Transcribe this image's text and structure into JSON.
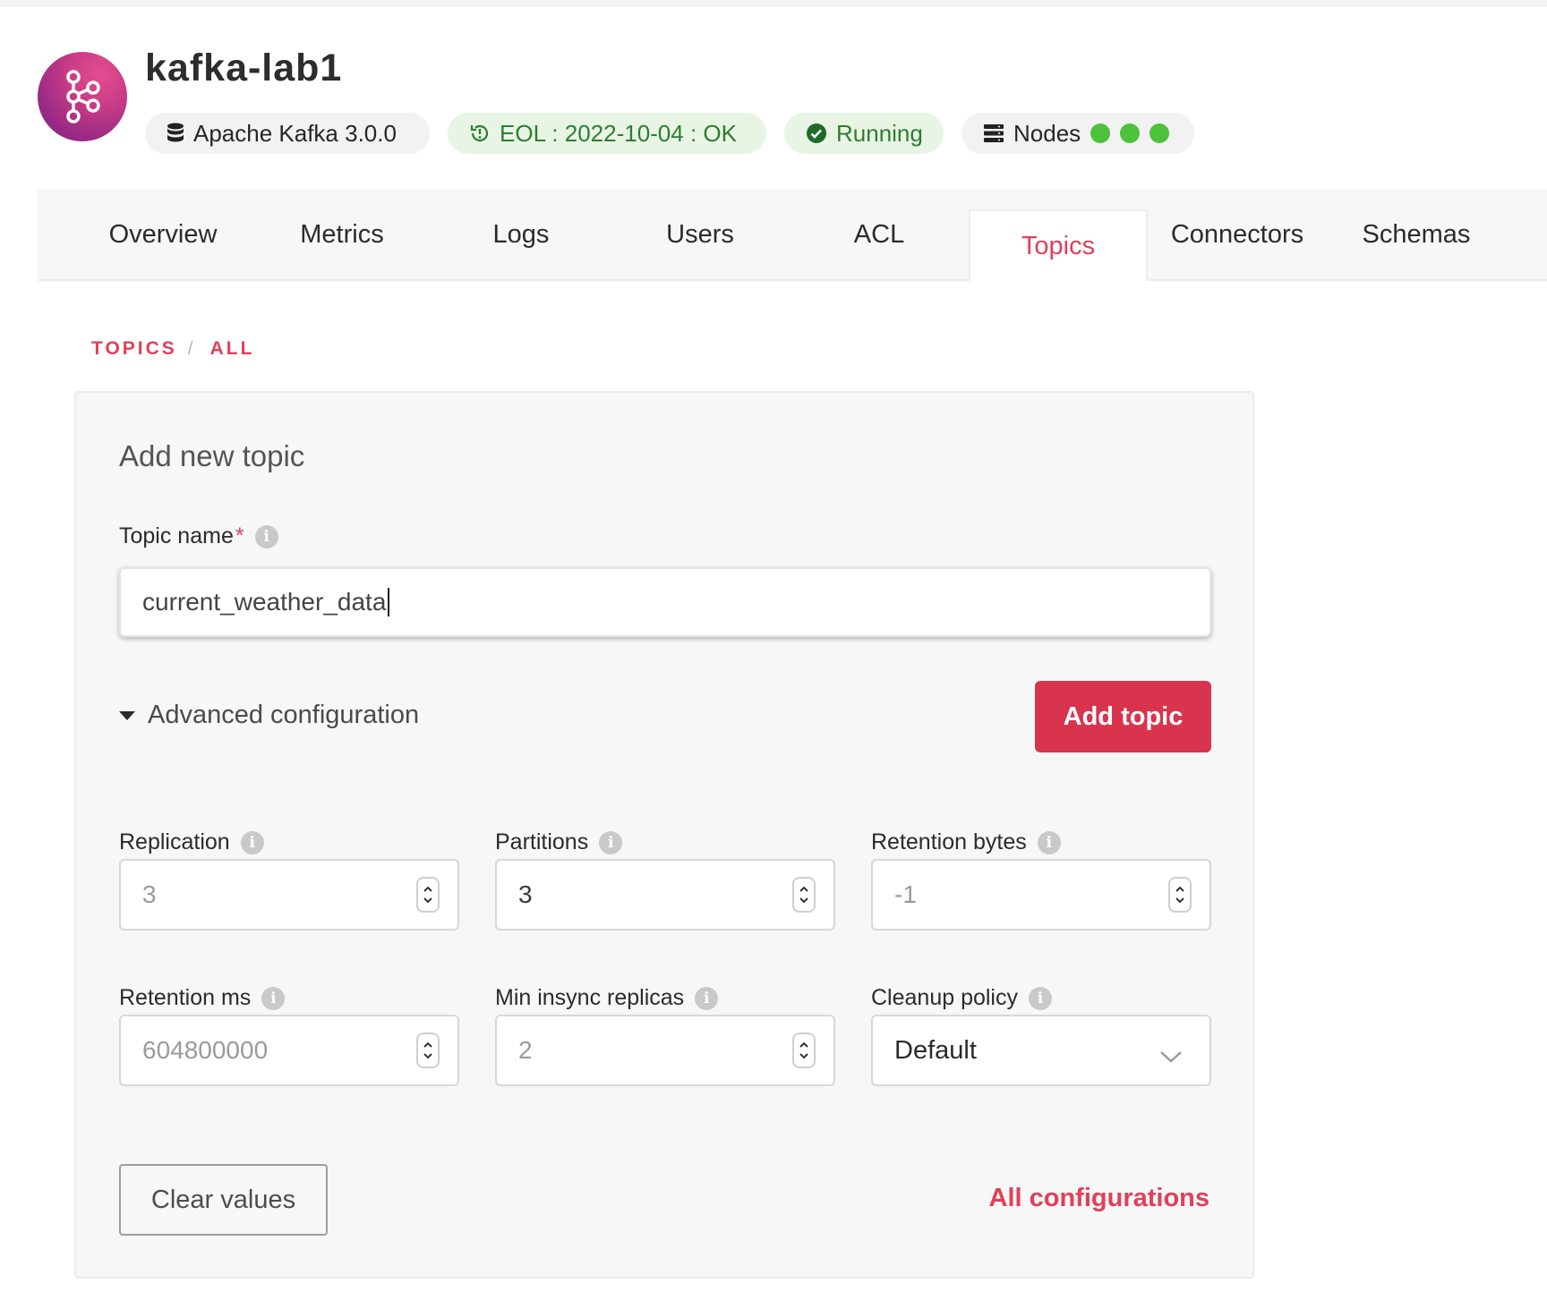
{
  "header": {
    "title": "kafka-lab1",
    "badges": {
      "version": "Apache Kafka 3.0.0",
      "eol": "EOL : 2022-10-04 : OK",
      "status": "Running",
      "nodes": "Nodes"
    },
    "node_count": 3,
    "colors": {
      "brand": "#c93c86",
      "ok_green": "#2e7d32",
      "node_dot": "#4cc23a",
      "accent": "#e0405a",
      "button": "#d8344e"
    }
  },
  "tabs": [
    "Overview",
    "Metrics",
    "Logs",
    "Users",
    "ACL",
    "Topics",
    "Connectors",
    "Schemas"
  ],
  "active_tab": "Topics",
  "breadcrumb": {
    "root": "TOPICS",
    "sep": "/",
    "current": "ALL"
  },
  "form": {
    "title": "Add new topic",
    "topic_name": {
      "label": "Topic name",
      "required_mark": "*",
      "value": "current_weather_data"
    },
    "advanced_label": "Advanced configuration",
    "add_button": "Add topic",
    "fields": {
      "replication": {
        "label": "Replication",
        "value": "3"
      },
      "partitions": {
        "label": "Partitions",
        "value": "3"
      },
      "retention_bytes": {
        "label": "Retention bytes",
        "value": "-1"
      },
      "retention_ms": {
        "label": "Retention ms",
        "value": "604800000"
      },
      "min_insync": {
        "label": "Min insync replicas",
        "value": "2"
      },
      "cleanup_policy": {
        "label": "Cleanup policy",
        "value": "Default"
      }
    },
    "clear_button": "Clear values",
    "all_configs_link": "All configurations"
  },
  "icons": [
    "kafka-logo-icon",
    "database-icon",
    "clock-alert-icon",
    "check-circle-icon",
    "server-icon",
    "info-icon",
    "caret-down-icon",
    "chevron-down-icon",
    "stepper-icon"
  ]
}
